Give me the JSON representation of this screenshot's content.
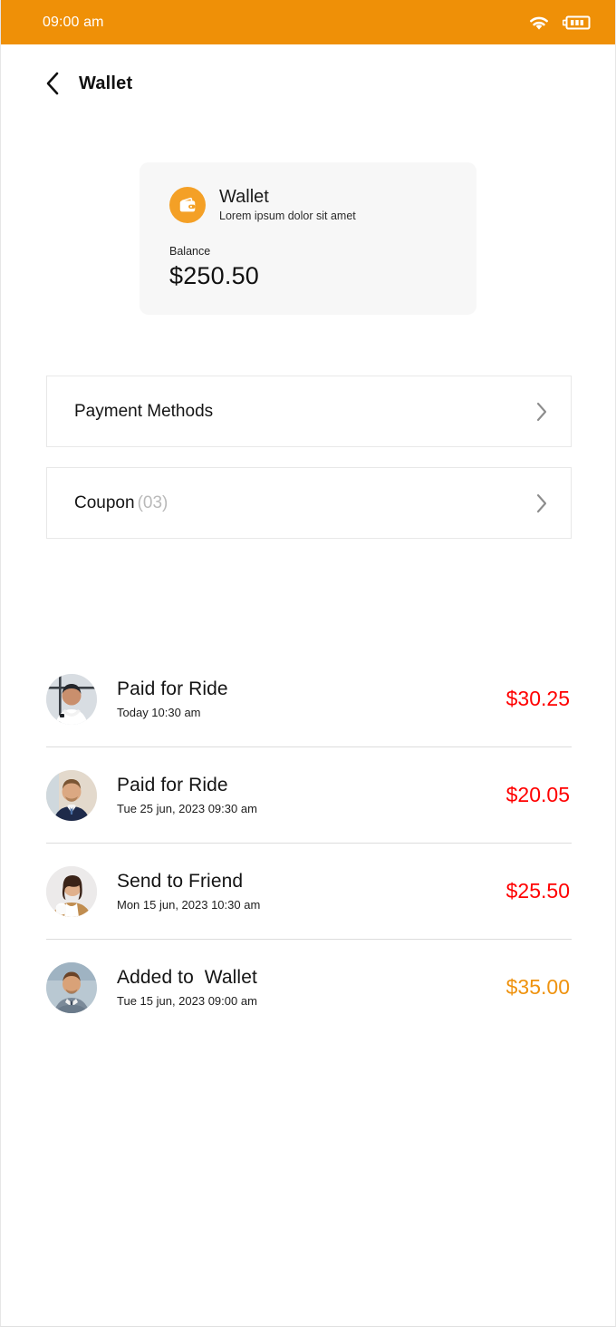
{
  "status_bar": {
    "time": "09:00 am",
    "wifi_icon": "wifi-icon",
    "battery_icon": "battery-icon",
    "background_color": "#EF9007"
  },
  "app_bar": {
    "back_icon": "chevron-left-icon",
    "title": "Wallet"
  },
  "wallet_card": {
    "icon": "wallet-icon",
    "icon_bg_color": "#F4A026",
    "name": "Wallet",
    "subtitle": "Lorem ipsum dolor sit amet",
    "balance_label": "Balance",
    "balance_value": "$250.50",
    "background_color": "#F7F7F7"
  },
  "menu": {
    "items": [
      {
        "label": "Payment Methods",
        "count": "",
        "chevron_icon": "chevron-right-icon"
      },
      {
        "label": "Coupon",
        "count": "(03)",
        "chevron_icon": "chevron-right-icon"
      }
    ]
  },
  "transactions": {
    "items": [
      {
        "avatar": "avatar-man-white-shirt",
        "title": "Paid for Ride",
        "date": "Today 10:30 am",
        "amount": "$30.25",
        "amount_color": "#FF0000"
      },
      {
        "avatar": "avatar-man-navy-suit",
        "title": "Paid for Ride",
        "date": "Tue 25 jun, 2023 09:30 am",
        "amount": "$20.05",
        "amount_color": "#FF0000"
      },
      {
        "avatar": "avatar-woman-tan-blazer",
        "title": "Send to Friend",
        "date": "Mon 15 jun, 2023 10:30 am",
        "amount": "$25.50",
        "amount_color": "#FF0000"
      },
      {
        "avatar": "avatar-man-gray-suit",
        "title": "Added to  Wallet",
        "date": "Tue 15 jun, 2023 09:00 am",
        "amount": "$35.00",
        "amount_color": "#EF9310"
      }
    ]
  }
}
